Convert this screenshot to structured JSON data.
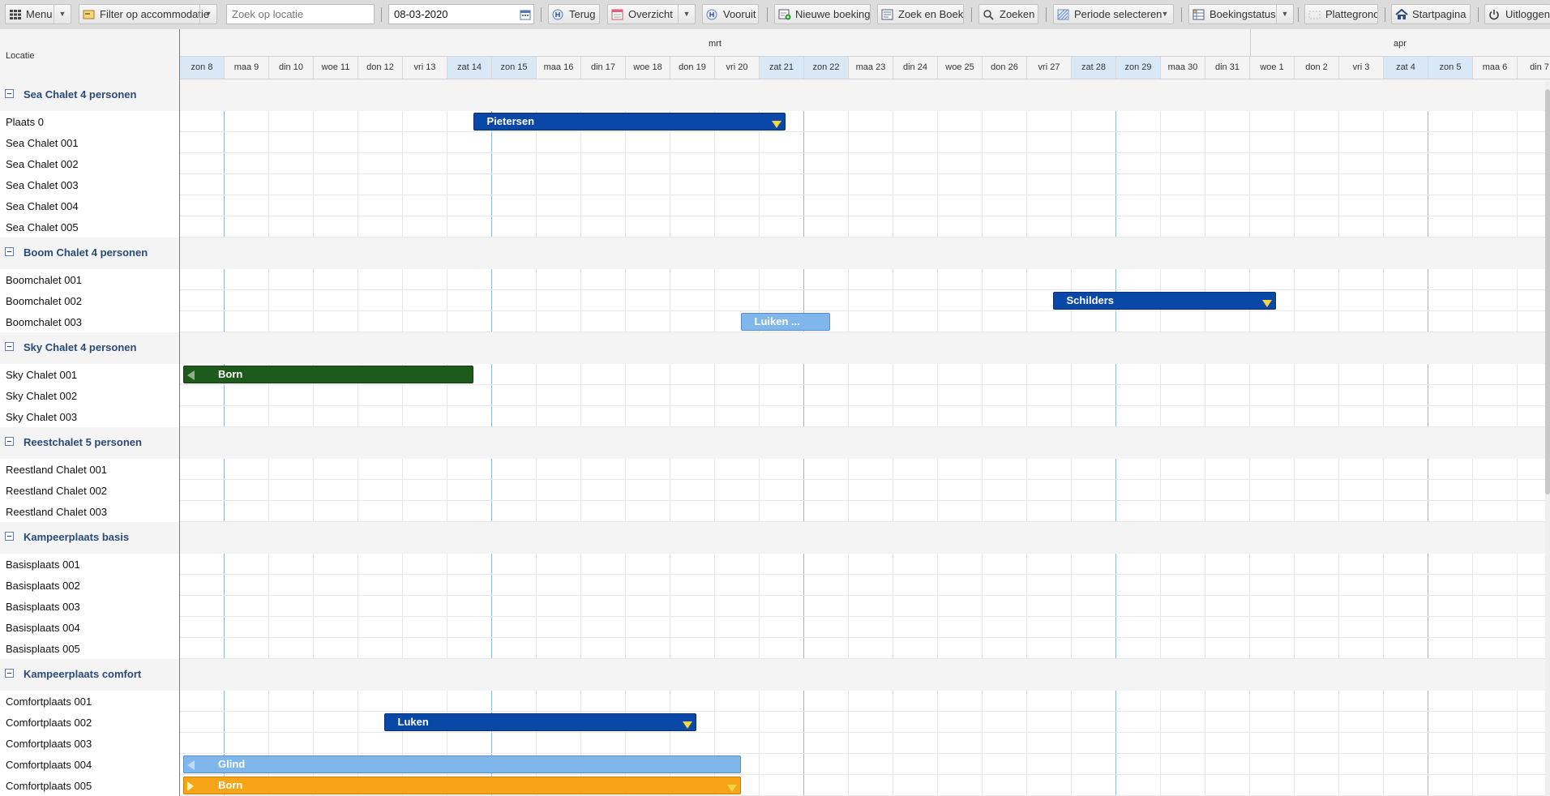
{
  "toolbar": {
    "menu": "Menu",
    "filter": "Filter op accommodatie",
    "search_placeholder": "Zoek op locatie",
    "date_value": "08-03-2020",
    "back": "Terug",
    "overview": "Overzicht",
    "forward": "Vooruit",
    "new_booking": "Nieuwe boeking",
    "search_and_book": "Zoek en Boek",
    "search": "Zoeken",
    "select_period": "Periode selecteren",
    "booking_status": "Boekingstatus",
    "floor_plan": "Plattegrond",
    "home": "Startpagina",
    "logout": "Uitloggen"
  },
  "location_header": "Locatie",
  "months": [
    {
      "label": "mrt"
    },
    {
      "label": "apr"
    }
  ],
  "days": [
    {
      "label": "zon 8",
      "weekend": true
    },
    {
      "label": "maa 9",
      "weekend": false
    },
    {
      "label": "din 10",
      "weekend": false
    },
    {
      "label": "woe 11",
      "weekend": false
    },
    {
      "label": "don 12",
      "weekend": false
    },
    {
      "label": "vri 13",
      "weekend": false
    },
    {
      "label": "zat 14",
      "weekend": true
    },
    {
      "label": "zon 15",
      "weekend": true
    },
    {
      "label": "maa 16",
      "weekend": false
    },
    {
      "label": "din 17",
      "weekend": false
    },
    {
      "label": "woe 18",
      "weekend": false
    },
    {
      "label": "don 19",
      "weekend": false
    },
    {
      "label": "vri 20",
      "weekend": false
    },
    {
      "label": "zat 21",
      "weekend": true
    },
    {
      "label": "zon 22",
      "weekend": true
    },
    {
      "label": "maa 23",
      "weekend": false
    },
    {
      "label": "din 24",
      "weekend": false
    },
    {
      "label": "woe 25",
      "weekend": false
    },
    {
      "label": "don 26",
      "weekend": false
    },
    {
      "label": "vri 27",
      "weekend": false
    },
    {
      "label": "zat 28",
      "weekend": true
    },
    {
      "label": "zon 29",
      "weekend": true
    },
    {
      "label": "maa 30",
      "weekend": false
    },
    {
      "label": "din 31",
      "weekend": false
    },
    {
      "label": "woe 1",
      "weekend": false
    },
    {
      "label": "don 2",
      "weekend": false
    },
    {
      "label": "vri 3",
      "weekend": false
    },
    {
      "label": "zat 4",
      "weekend": true
    },
    {
      "label": "zon 5",
      "weekend": true
    },
    {
      "label": "maa 6",
      "weekend": false
    },
    {
      "label": "din 7",
      "weekend": false
    }
  ],
  "groups": [
    {
      "name": "Sea Chalet 4 personen",
      "items": [
        "Plaats 0",
        "Sea Chalet 001",
        "Sea Chalet 002",
        "Sea Chalet 003",
        "Sea Chalet 004",
        "Sea Chalet 005"
      ]
    },
    {
      "name": "Boom Chalet 4 personen",
      "items": [
        "Boomchalet 001",
        "Boomchalet 002",
        "Boomchalet 003"
      ]
    },
    {
      "name": "Sky Chalet 4 personen",
      "items": [
        "Sky Chalet 001",
        "Sky Chalet 002",
        "Sky Chalet 003"
      ]
    },
    {
      "name": "Reestchalet 5 personen",
      "items": [
        "Reestland Chalet 001",
        "Reestland Chalet 002",
        "Reestland Chalet 003"
      ]
    },
    {
      "name": "Kampeerplaats basis",
      "items": [
        "Basisplaats 001",
        "Basisplaats 002",
        "Basisplaats 003",
        "Basisplaats 004",
        "Basisplaats 005"
      ]
    },
    {
      "name": "Kampeerplaats comfort",
      "items": [
        "Comfortplaats 001",
        "Comfortplaats 002",
        "Comfortplaats 003",
        "Comfortplaats 004",
        "Comfortplaats 005"
      ]
    }
  ],
  "bookings": [
    {
      "label": "Pietersen",
      "location": "Plaats 0",
      "start_day": 6.5,
      "end_day": 13.5,
      "color": "#0a48a8",
      "style": "dark",
      "marker": "down"
    },
    {
      "label": "Schilders",
      "location": "Boomchalet 002",
      "start_day": 19.5,
      "end_day": 24.5,
      "color": "#0a48a8",
      "style": "dark",
      "marker": "down"
    },
    {
      "label": "Luiken ...",
      "location": "Boomchalet 003",
      "start_day": 12.5,
      "end_day": 14.5,
      "color": "#7fb6ec",
      "style": "light",
      "marker": "none"
    },
    {
      "label": "Born",
      "location": "Sky Chalet 001",
      "start_day": 0,
      "end_day": 6.5,
      "color": "#1e5a1c",
      "style": "green",
      "marker": "left"
    },
    {
      "label": "Luken",
      "location": "Comfortplaats 002",
      "start_day": 4.5,
      "end_day": 11.5,
      "color": "#0a48a8",
      "style": "dark",
      "marker": "down"
    },
    {
      "label": "Glind",
      "location": "Comfortplaats 004",
      "start_day": 0,
      "end_day": 12.5,
      "color": "#7fb6ec",
      "style": "light",
      "marker": "left"
    },
    {
      "label": "Born",
      "location": "Comfortplaats 005",
      "start_day": 0,
      "end_day": 12.5,
      "color": "#f7a416",
      "style": "orange",
      "marker": "right-down"
    }
  ]
}
